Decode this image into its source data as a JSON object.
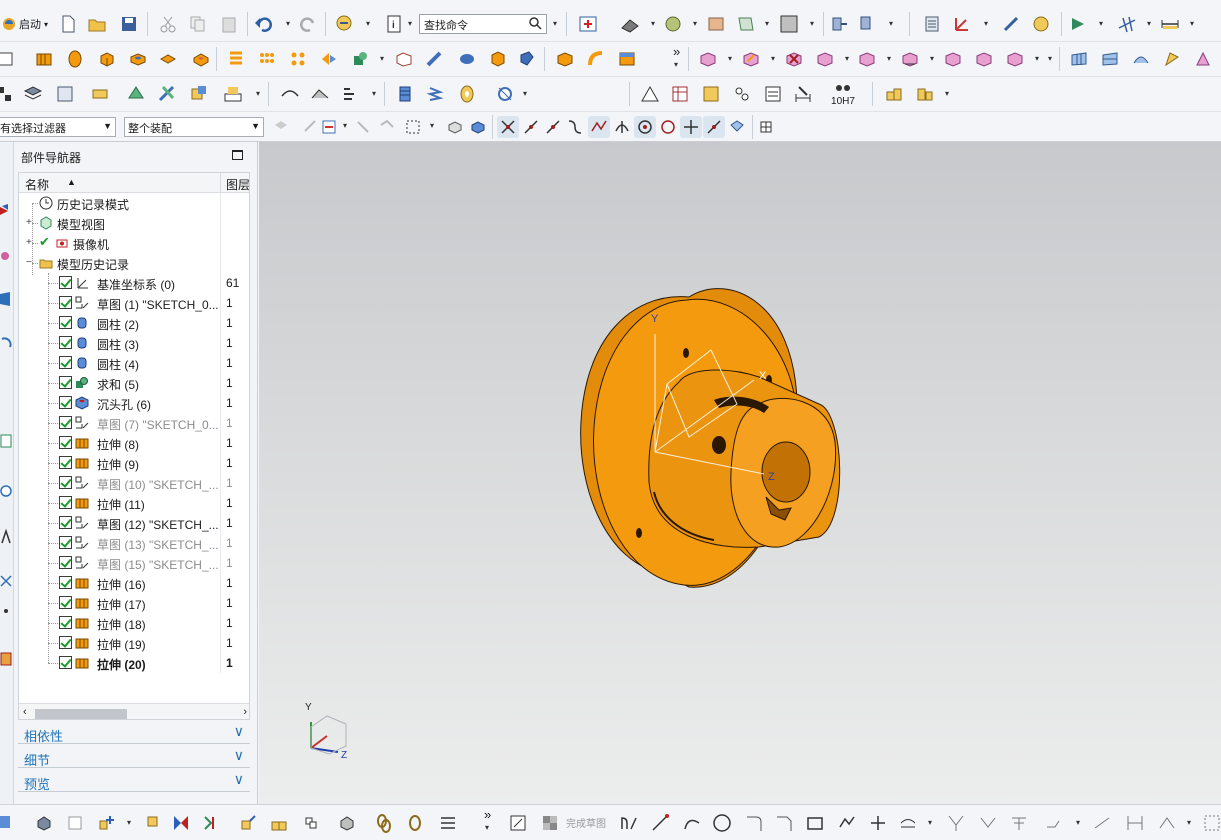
{
  "toolbar": {
    "start_label": "启动",
    "search_placeholder": "查找命令",
    "zoom_label": "10H7",
    "more_label": "»"
  },
  "selection_bar": {
    "filter_value": "有选择过滤器",
    "scope_value": "整个装配"
  },
  "navigator": {
    "title": "部件导航器",
    "col_name": "名称",
    "col_layer": "图层",
    "nodes": [
      {
        "label": "历史记录模式",
        "icon": "clock-icon"
      },
      {
        "label": "模型视图",
        "icon": "model-views-icon"
      },
      {
        "label": "摄像机",
        "icon": "camera-icon"
      },
      {
        "label": "模型历史记录",
        "icon": "folder-open-icon"
      }
    ],
    "features": [
      {
        "label": "基准坐标系 (0)",
        "layer": "61",
        "icon": "datum-csys-icon",
        "dim": false,
        "bold": false
      },
      {
        "label": "草图 (1) \"SKETCH_0...",
        "layer": "1",
        "icon": "sketch-icon",
        "dim": false,
        "bold": false
      },
      {
        "label": "圆柱 (2)",
        "layer": "1",
        "icon": "cylinder-icon",
        "dim": false,
        "bold": false
      },
      {
        "label": "圆柱 (3)",
        "layer": "1",
        "icon": "cylinder-icon",
        "dim": false,
        "bold": false
      },
      {
        "label": "圆柱 (4)",
        "layer": "1",
        "icon": "cylinder-icon",
        "dim": false,
        "bold": false
      },
      {
        "label": "求和 (5)",
        "layer": "1",
        "icon": "unite-icon",
        "dim": false,
        "bold": false
      },
      {
        "label": "沉头孔 (6)",
        "layer": "1",
        "icon": "counterbore-icon",
        "dim": false,
        "bold": false
      },
      {
        "label": "草图 (7) \"SKETCH_0...",
        "layer": "1",
        "icon": "sketch-icon",
        "dim": true,
        "bold": false
      },
      {
        "label": "拉伸 (8)",
        "layer": "1",
        "icon": "extrude-icon",
        "dim": false,
        "bold": false
      },
      {
        "label": "拉伸 (9)",
        "layer": "1",
        "icon": "extrude-icon",
        "dim": false,
        "bold": false
      },
      {
        "label": "草图 (10) \"SKETCH_...",
        "layer": "1",
        "icon": "sketch-icon",
        "dim": true,
        "bold": false
      },
      {
        "label": "拉伸 (11)",
        "layer": "1",
        "icon": "extrude-icon",
        "dim": false,
        "bold": false
      },
      {
        "label": "草图 (12) \"SKETCH_...",
        "layer": "1",
        "icon": "sketch-icon",
        "dim": false,
        "bold": false
      },
      {
        "label": "草图 (13) \"SKETCH_...",
        "layer": "1",
        "icon": "sketch-icon",
        "dim": true,
        "bold": false
      },
      {
        "label": "草图 (15) \"SKETCH_...",
        "layer": "1",
        "icon": "sketch-icon",
        "dim": true,
        "bold": false
      },
      {
        "label": "拉伸 (16)",
        "layer": "1",
        "icon": "extrude-icon",
        "dim": false,
        "bold": false
      },
      {
        "label": "拉伸 (17)",
        "layer": "1",
        "icon": "extrude-icon",
        "dim": false,
        "bold": false
      },
      {
        "label": "拉伸 (18)",
        "layer": "1",
        "icon": "extrude-icon",
        "dim": false,
        "bold": false
      },
      {
        "label": "拉伸 (19)",
        "layer": "1",
        "icon": "extrude-icon",
        "dim": false,
        "bold": false
      },
      {
        "label": "拉伸 (20)",
        "layer": "1",
        "icon": "extrude-icon",
        "dim": false,
        "bold": true
      }
    ],
    "panels": [
      "相依性",
      "细节",
      "预览"
    ]
  },
  "graphics": {
    "model_color": "#f39a0e",
    "axes": {
      "x": "X",
      "y": "Y",
      "z": "Z"
    }
  },
  "bottom_bar": {
    "finish_sketch_label": "完成草图"
  }
}
